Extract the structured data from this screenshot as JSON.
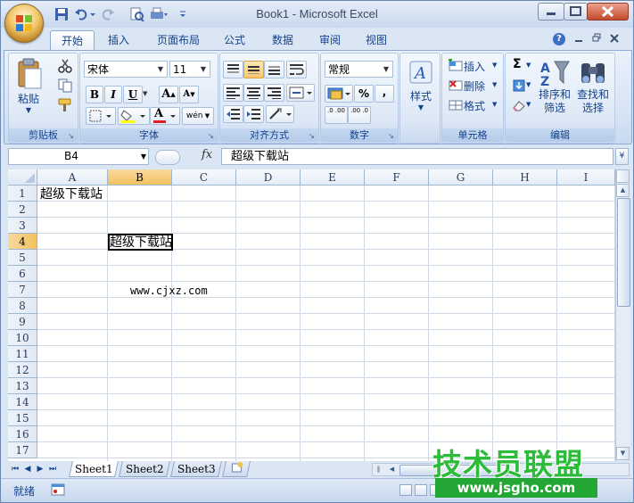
{
  "app": {
    "title": "Book1 - Microsoft Excel"
  },
  "tabs": [
    {
      "label": "开始",
      "active": true
    },
    {
      "label": "插入"
    },
    {
      "label": "页面布局"
    },
    {
      "label": "公式"
    },
    {
      "label": "数据"
    },
    {
      "label": "审阅"
    },
    {
      "label": "视图"
    }
  ],
  "ribbon": {
    "clipboard": {
      "label": "剪贴板",
      "paste_label": "粘贴"
    },
    "font": {
      "label": "字体",
      "font_name": "宋体",
      "font_size": "11",
      "bold": "B",
      "italic": "I",
      "underline": "U",
      "grow": "A",
      "shrink": "A",
      "font_color_glyph": "A",
      "phonetic": "wén"
    },
    "alignment": {
      "label": "对齐方式"
    },
    "number": {
      "label": "数字",
      "format": "常规",
      "percent": "%",
      "comma": ",",
      "inc_decimal": ".0 .00",
      "dec_decimal": ".00 .0"
    },
    "styles": {
      "label": "样式"
    },
    "cells": {
      "label": "单元格",
      "insert": "插入",
      "delete": "删除",
      "format": "格式"
    },
    "editing": {
      "label": "编辑",
      "sort_filter_1": "排序和",
      "sort_filter_2": "筛选",
      "find_select_1": "查找和",
      "find_select_2": "选择",
      "sigma": "Σ"
    }
  },
  "formula_bar": {
    "name_box": "B4",
    "fx": "fx",
    "value": "超级下载站"
  },
  "grid": {
    "columns": [
      "A",
      "B",
      "C",
      "D",
      "E",
      "F",
      "G",
      "H",
      "I"
    ],
    "rows": [
      "1",
      "2",
      "3",
      "4",
      "5",
      "6",
      "7",
      "8",
      "9",
      "10",
      "11",
      "12",
      "13",
      "14",
      "15",
      "16",
      "17"
    ],
    "selected_cell": "B4",
    "cells": {
      "A1": "超级下载站",
      "B4": "超级下载站",
      "B7": "www.cjxz.com"
    }
  },
  "sheets": [
    {
      "label": "Sheet1",
      "active": true
    },
    {
      "label": "Sheet2"
    },
    {
      "label": "Sheet3"
    }
  ],
  "status": {
    "ready": "就绪"
  },
  "watermark": {
    "title": "技术员联盟",
    "url": "www.jsgho.com"
  },
  "colors": {
    "accent": "#15428b",
    "selection": "#f1c15f",
    "watermark_green": "#2dbb3a"
  }
}
